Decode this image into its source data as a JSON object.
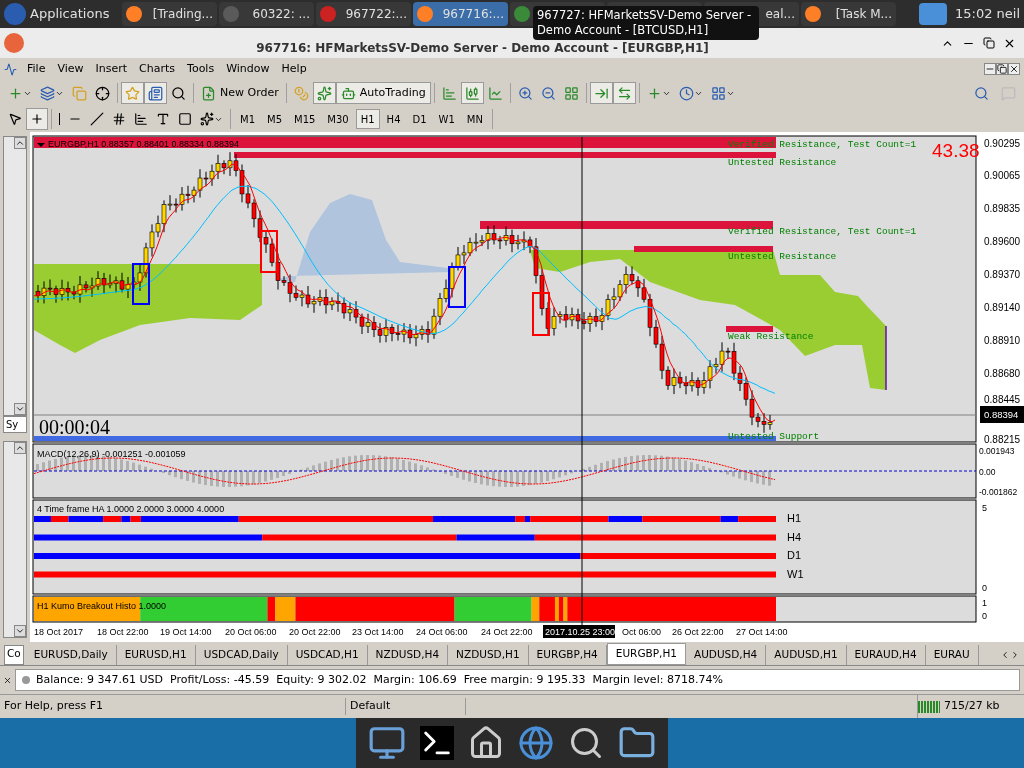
{
  "taskbar": {
    "menu": "Applications",
    "items": [
      {
        "label": "[Trading...",
        "selected": false
      },
      {
        "label": "60322: ...",
        "selected": false
      },
      {
        "label": "967722:...",
        "selected": false
      },
      {
        "label": "967716:...",
        "selected": true
      },
      {
        "selected": false
      },
      {
        "selected": false
      },
      {
        "label": "eal...",
        "selected": false
      },
      {
        "label": "[Task M...",
        "selected": false
      }
    ],
    "clock": "15:02",
    "user": "neil"
  },
  "tooltip": "967727: HFMarketsSV-Demo Server - Demo Account - [BTCUSD,H1]",
  "window": {
    "title": "967716: HFMarketsSV-Demo Server - Demo Account - [EURGBP,H1]"
  },
  "menu": [
    "File",
    "View",
    "Insert",
    "Charts",
    "Tools",
    "Window",
    "Help"
  ],
  "toolbar": {
    "new_order": "New Order",
    "autotrading": {
      "label": "AutoTrading",
      "on": true
    }
  },
  "timeframes": [
    {
      "label": "M1",
      "selected": false
    },
    {
      "label": "M5",
      "selected": false
    },
    {
      "label": "M15",
      "selected": false
    },
    {
      "label": "M30",
      "selected": false
    },
    {
      "label": "H1",
      "selected": true
    },
    {
      "label": "H4",
      "selected": false
    },
    {
      "label": "D1",
      "selected": false
    },
    {
      "label": "W1",
      "selected": false
    },
    {
      "label": "MN",
      "selected": false
    }
  ],
  "navigator": {
    "tab": "Sy"
  },
  "chart": {
    "header": "EURGBP,H1 0.88357 0.88401 0.88334 0.88394",
    "spread": "43.38",
    "timer": "00:00:04",
    "zones": [
      {
        "label": "Verified Resistance, Test Count=1"
      },
      {
        "label": "Untested Resistance"
      },
      {
        "label": "Verified Resistance, Test Count=1"
      },
      {
        "label": "Untested Resistance"
      },
      {
        "label": "Weak Resistance"
      },
      {
        "label": "Untested Support"
      }
    ],
    "price_ticks": [
      "0.90295",
      "0.90065",
      "0.89835",
      "0.89600",
      "0.89370",
      "0.89140",
      "0.88910",
      "0.88680",
      "0.88445",
      "0.88215"
    ],
    "current_price": "0.88394"
  },
  "macd": {
    "label": "MACD(12,26,9) -0.001251 -0.001059",
    "ticks": [
      "0.001943",
      "0.00",
      "-0.001862"
    ]
  },
  "ha": {
    "label": "4 Time frame HA 1.0000 2.0000 3.0000 4.0000",
    "ticks": [
      "5",
      "0"
    ],
    "rows": [
      {
        "name": "H1"
      },
      {
        "name": "H4"
      },
      {
        "name": "D1"
      },
      {
        "name": "W1"
      }
    ]
  },
  "kumo": {
    "label": "H1 Kumo Breakout Histo",
    "value": "1.0000",
    "ticks": [
      "1",
      "0"
    ]
  },
  "time_axis": [
    {
      "label": "18 Oct 2017",
      "selected": false
    },
    {
      "label": "18 Oct 22:00",
      "selected": false
    },
    {
      "label": "19 Oct 14:00",
      "selected": false
    },
    {
      "label": "20 Oct 06:00",
      "selected": false
    },
    {
      "label": "20 Oct 22:00",
      "selected": false
    },
    {
      "label": "23 Oct 14:00",
      "selected": false
    },
    {
      "label": "24 Oct 06:00",
      "selected": false
    },
    {
      "label": "24 Oct 22:00",
      "selected": false
    },
    {
      "label": "2017.10.25 23:00",
      "selected": true
    },
    {
      "label": "Oct 06:00",
      "selected": false
    },
    {
      "label": "26 Oct 22:00",
      "selected": false
    },
    {
      "label": "27 Oct 14:00",
      "selected": false
    }
  ],
  "chart_tabs": {
    "left": "Co",
    "tabs": [
      {
        "label": "EURUSD,Daily",
        "selected": false
      },
      {
        "label": "EURUSD,H1",
        "selected": false
      },
      {
        "label": "USDCAD,Daily",
        "selected": false
      },
      {
        "label": "USDCAD,H1",
        "selected": false
      },
      {
        "label": "NZDUSD,H4",
        "selected": false
      },
      {
        "label": "NZDUSD,H1",
        "selected": false
      },
      {
        "label": "EURGBP,H4",
        "selected": false
      },
      {
        "label": "EURGBP,H1",
        "selected": true
      },
      {
        "label": "AUDUSD,H4",
        "selected": false
      },
      {
        "label": "AUDUSD,H1",
        "selected": false
      },
      {
        "label": "EURAUD,H4",
        "selected": false
      },
      {
        "label": "EURAU",
        "selected": false
      }
    ]
  },
  "terminal": "Balance: 9 347.61 USD  Profit/Loss: -45.59  Equity: 9 302.02  Margin: 106.69  Free margin: 9 195.33  Margin level: 8718.74%",
  "status_bar": [
    "For Help, press F1",
    "Default",
    "715/27 kb"
  ]
}
